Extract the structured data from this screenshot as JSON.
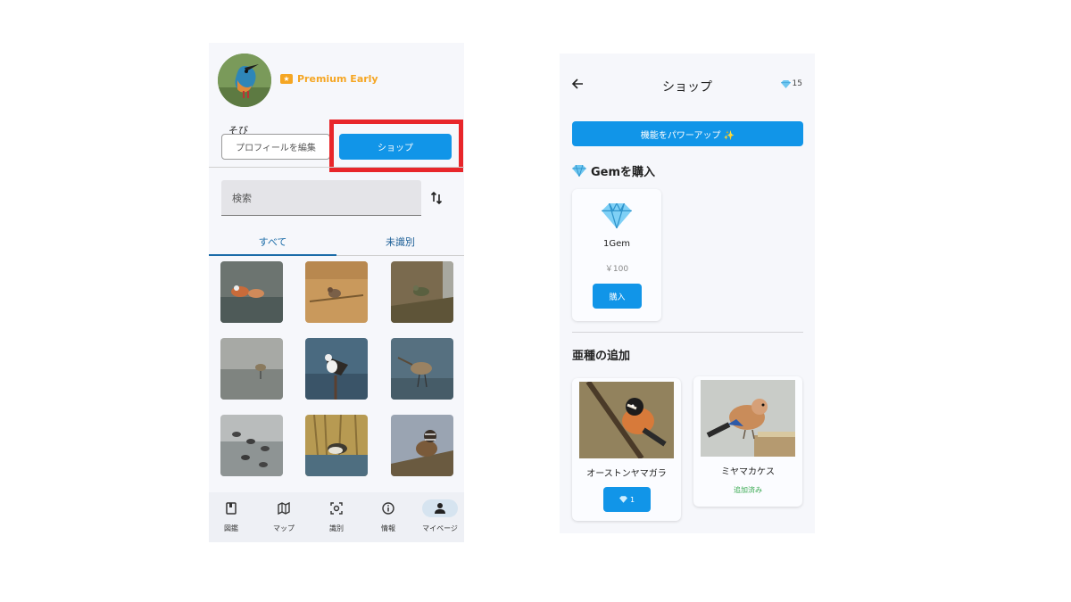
{
  "profile": {
    "badge_label": "Premium Early",
    "username": "そび",
    "edit_button": "プロフィールを編集",
    "shop_button": "ショップ"
  },
  "search": {
    "placeholder": "検索"
  },
  "tabs": [
    {
      "label": "すべて"
    },
    {
      "label": "未識別"
    }
  ],
  "bottom_nav": [
    {
      "label": "図鑑",
      "icon": "book-icon"
    },
    {
      "label": "マップ",
      "icon": "map-icon"
    },
    {
      "label": "識別",
      "icon": "camera-scan-icon"
    },
    {
      "label": "情報",
      "icon": "info-icon"
    },
    {
      "label": "マイページ",
      "icon": "person-icon"
    }
  ],
  "shop": {
    "title": "ショップ",
    "gem_balance": "15",
    "powerup_button": "機能をパワーアップ ✨",
    "gem_section_title": "Gemを購入",
    "gem_product": {
      "name": "1Gem",
      "price": "￥100",
      "buy_label": "購入"
    },
    "subspecies_section_title": "亜種の追加",
    "subspecies": [
      {
        "name": "オーストンヤマガラ",
        "price": "1"
      },
      {
        "name": "ミヤマカケス",
        "status": "追加済み"
      }
    ]
  },
  "colors": {
    "accent": "#1195e8",
    "premium": "#f5a623",
    "highlight": "#e8262a",
    "added": "#3aaa52"
  }
}
